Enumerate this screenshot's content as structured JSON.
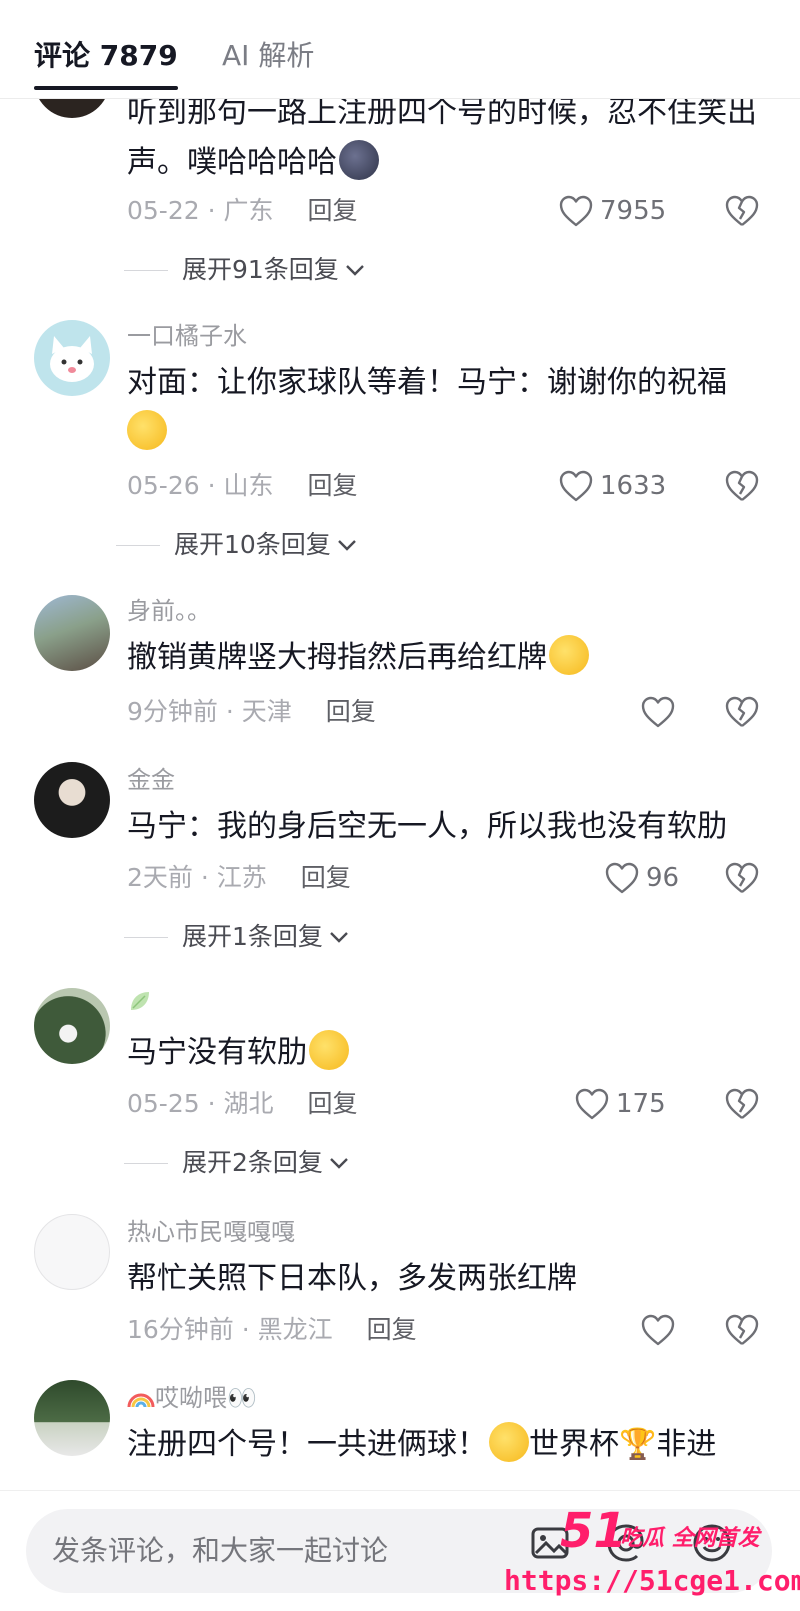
{
  "header": {
    "tab_comments": "评论 7879",
    "tab_ai": "AI 解析"
  },
  "comments": [
    {
      "username": "",
      "text": "听到那句一路上注册四个号的时候，忍不住笑出声。噗哈哈哈哈",
      "emoji": "moon-face-emoji",
      "time": "05-22",
      "location": "广东",
      "reply_label": "回复",
      "likes": "7955",
      "expand": "展开91条回复"
    },
    {
      "username": "一口橘子水",
      "text": "对面：让你家球队等着！马宁：谢谢你的祝福",
      "emoji": "pleading-face-emoji",
      "time": "05-26",
      "location": "山东",
      "reply_label": "回复",
      "likes": "1633",
      "expand": "展开10条回复"
    },
    {
      "username": "身前。。",
      "text": "撤销黄牌竖大拇指然后再给红牌",
      "emoji": "crying-laughing-emoji",
      "time": "9分钟前",
      "location": "天津",
      "reply_label": "回复",
      "likes": ""
    },
    {
      "username": "金金",
      "text": "马宁：我的身后空无一人，所以我也没有软肋",
      "time": "2天前",
      "location": "江苏",
      "reply_label": "回复",
      "likes": "96",
      "expand": "展开1条回复"
    },
    {
      "username": "",
      "text": "马宁没有软肋",
      "emoji": "wink-tongue-emoji",
      "time": "05-25",
      "location": "湖北",
      "reply_label": "回复",
      "likes": "175",
      "expand": "展开2条回复"
    },
    {
      "username": "热心市民嘎嘎嘎",
      "text": "帮忙关照下日本队，多发两张红牌",
      "time": "16分钟前",
      "location": "黑龙江",
      "reply_label": "回复",
      "likes": ""
    },
    {
      "username": "哎呦喂",
      "text": "注册四个号！一共进俩球！",
      "text_tail": "世界杯",
      "text_end": "非进",
      "time": "",
      "location": ""
    }
  ],
  "bottom": {
    "placeholder": "发条评论，和大家一起讨论"
  },
  "watermark": {
    "number": "51",
    "tagline": "吃瓜 全网首发",
    "url": "https://51cge1.com"
  },
  "colors": {
    "text_primary": "#161823",
    "text_secondary": "#a9aab0",
    "watermark": "#ff1e6b"
  }
}
